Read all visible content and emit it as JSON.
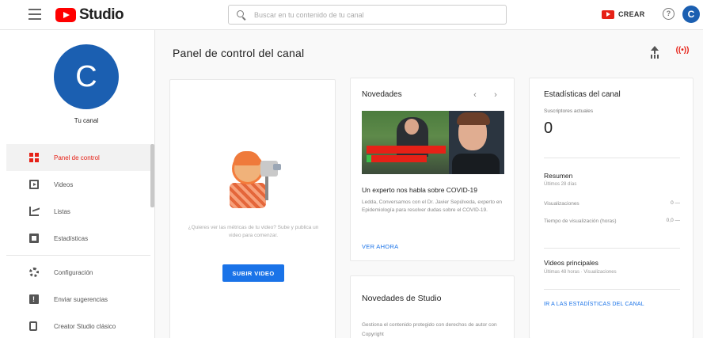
{
  "header": {
    "logo_text": "Studio",
    "search_placeholder": "Buscar en tu contenido de tu canal",
    "create_label": "CREAR",
    "help_glyph": "?",
    "avatar_letter": "C"
  },
  "sidebar": {
    "avatar_letter": "C",
    "channel_name": "Tu canal",
    "items": [
      {
        "label": "Panel de control",
        "icon": "dashboard-icon",
        "active": true
      },
      {
        "label": "Videos",
        "icon": "video-icon"
      },
      {
        "label": "Listas",
        "icon": "analytics-icon"
      },
      {
        "label": "Estadísticas",
        "icon": "comments-icon"
      },
      {
        "label": "Configuración",
        "icon": "gear-icon"
      },
      {
        "label": "Enviar sugerencias",
        "icon": "feedback-icon"
      },
      {
        "label": "Creator Studio clásico",
        "icon": "classic-studio-icon"
      }
    ]
  },
  "main": {
    "title": "Panel de control del canal",
    "live_glyph": "((•))"
  },
  "upload_card": {
    "text": "¿Quieres ver las métricas de tu video? Sube y publica un video para comenzar.",
    "button_label": "SUBIR VIDEO"
  },
  "news_card": {
    "title": "Novedades",
    "prev_glyph": "‹",
    "next_glyph": "›",
    "headline": "Un experto nos habla sobre COVID-19",
    "description": "Ledda, Conversamos con el Dr. Javier Sepúlveda, experto en Epidemiología para resolver dudas sobre el COVID-19.",
    "link_label": "VER AHORA"
  },
  "studio_card": {
    "title": "Novedades de Studio",
    "description": "Gestiona el contenido protegido con derechos de autor con Copyright"
  },
  "stats_card": {
    "title": "Estadísticas del canal",
    "subs_label": "Suscriptores actuales",
    "subs_value": "0",
    "summary_title": "Resumen",
    "summary_period": "Últimos 28 días",
    "rows": [
      {
        "label": "Visualizaciones",
        "value": "0 —"
      },
      {
        "label": "Tiempo de visualización (horas)",
        "value": "0,0 —"
      }
    ],
    "videos_title": "Videos principales",
    "videos_sub": "Últimas 48 horas · Visualizaciones",
    "link_label": "IR A LAS ESTADÍSTICAS DEL CANAL"
  }
}
